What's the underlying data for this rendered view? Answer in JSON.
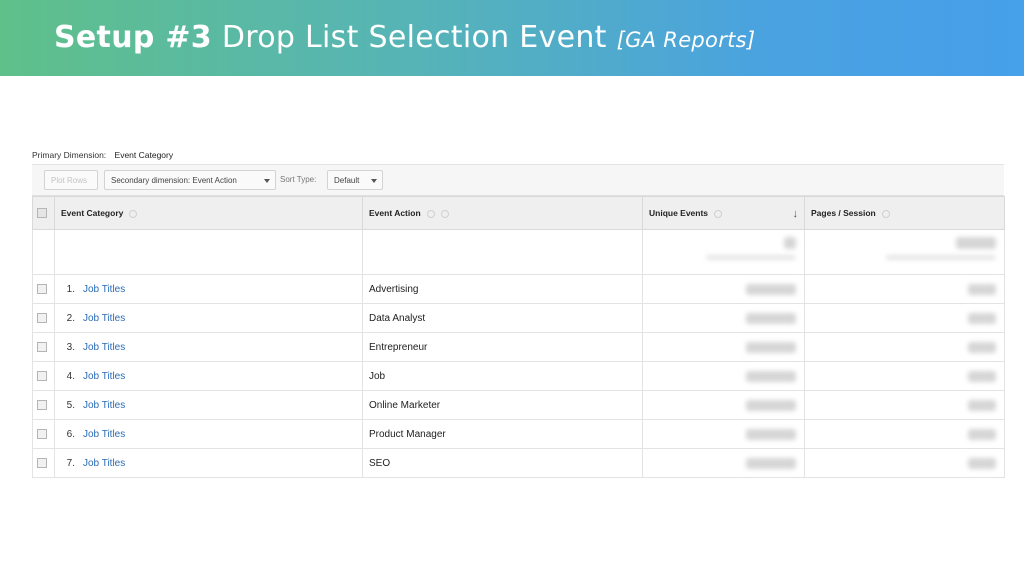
{
  "banner": {
    "title_bold": "Setup #3",
    "title_main": "Drop List Selection Event",
    "title_italic": "[GA Reports]",
    "gradient_colors": [
      "#5fc08a",
      "#46a0ea"
    ]
  },
  "report": {
    "primary_dimension_label": "Primary Dimension:",
    "primary_dimension_value": "Event Category",
    "plot_rows_label": "Plot Rows",
    "secondary_dimension_label": "Secondary dimension: Event Action",
    "sort_type_label": "Sort Type:",
    "sort_type_value": "Default",
    "columns": {
      "event_category": "Event Category",
      "event_action": "Event Action",
      "unique_events": "Unique Events",
      "pages_session": "Pages / Session"
    },
    "rows": [
      {
        "index": "1.",
        "category": "Job Titles",
        "action": "Advertising"
      },
      {
        "index": "2.",
        "category": "Job Titles",
        "action": "Data Analyst"
      },
      {
        "index": "3.",
        "category": "Job Titles",
        "action": "Entrepreneur"
      },
      {
        "index": "4.",
        "category": "Job Titles",
        "action": "Job"
      },
      {
        "index": "5.",
        "category": "Job Titles",
        "action": "Online Marketer"
      },
      {
        "index": "6.",
        "category": "Job Titles",
        "action": "Product Manager"
      },
      {
        "index": "7.",
        "category": "Job Titles",
        "action": "SEO"
      }
    ],
    "link_color": "#2a6bb5"
  }
}
